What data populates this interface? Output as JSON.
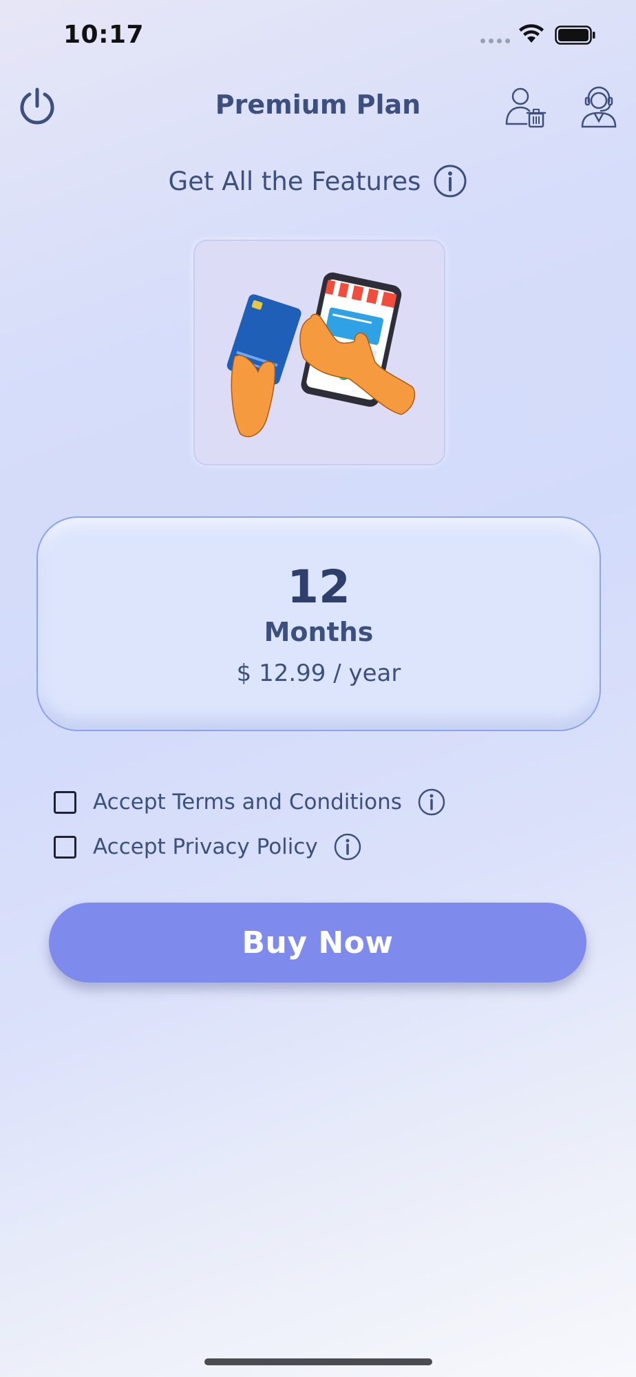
{
  "status_bar": {
    "time": "10:17"
  },
  "header": {
    "title": "Premium Plan",
    "power_icon": "power-icon",
    "delete_account_icon": "user-trash-icon",
    "support_icon": "customer-support-icon"
  },
  "subtitle": {
    "text": "Get All the Features",
    "icon": "info-icon"
  },
  "plan": {
    "number": "12",
    "unit": "Months",
    "price": "$ 12.99 / year"
  },
  "agreements": {
    "terms_label": "Accept Terms and Conditions",
    "privacy_label": "Accept Privacy Policy",
    "terms_checked": false,
    "privacy_checked": false
  },
  "actions": {
    "buy_label": "Buy Now"
  },
  "colors": {
    "accent": "#7f8bec",
    "text": "#3d4f7e",
    "card_border": "#8da1ec"
  }
}
